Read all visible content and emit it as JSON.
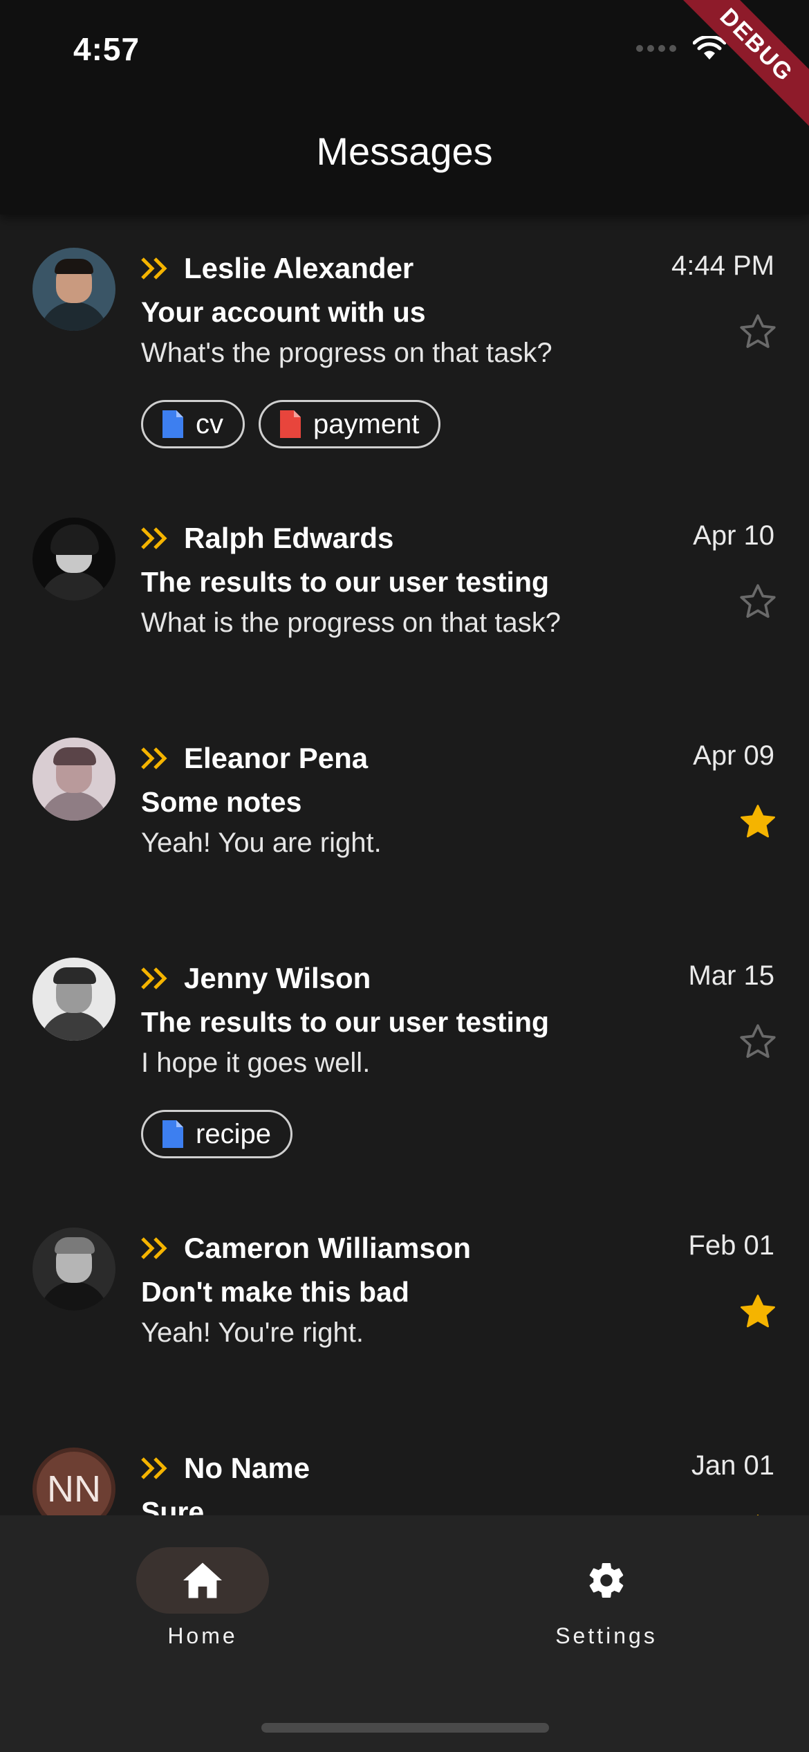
{
  "status_bar": {
    "time": "4:57",
    "debug_label": "DEBUG"
  },
  "app_bar": {
    "title": "Messages"
  },
  "messages": [
    {
      "name": "Leslie Alexander",
      "date": "4:44 PM",
      "subject": "Your account with us",
      "preview": "What's the progress on that task?",
      "starred": false,
      "attachments": [
        {
          "label": "cv",
          "color": "#3d7ff0"
        },
        {
          "label": "payment",
          "color": "#e8453c"
        }
      ]
    },
    {
      "name": "Ralph Edwards",
      "date": "Apr 10",
      "subject": "The results to our user testing",
      "preview": "What is the progress on that task?",
      "starred": false,
      "attachments": []
    },
    {
      "name": "Eleanor Pena",
      "date": "Apr 09",
      "subject": "Some notes",
      "preview": "Yeah! You are right.",
      "starred": true,
      "attachments": []
    },
    {
      "name": "Jenny Wilson",
      "date": "Mar 15",
      "subject": "The results to our user testing",
      "preview": "I hope it goes well.",
      "starred": false,
      "attachments": [
        {
          "label": "recipe",
          "color": "#3d7ff0"
        }
      ]
    },
    {
      "name": "Cameron Williamson",
      "date": "Feb 01",
      "subject": "Don't make this bad",
      "preview": "Yeah! You're right.",
      "starred": true,
      "attachments": []
    },
    {
      "name": "No Name",
      "date": "Jan 01",
      "subject": "Sure",
      "initials": "NN",
      "starred": true,
      "attachments": []
    }
  ],
  "bottom_nav": {
    "items": [
      {
        "label": "Home",
        "icon": "home-icon",
        "active": true
      },
      {
        "label": "Settings",
        "icon": "gear-icon",
        "active": false
      }
    ]
  },
  "colors": {
    "accent": "#f5b400",
    "star_active": "#f5b400",
    "star_inactive": "#6a6a6a",
    "background": "#1b1b1b"
  }
}
